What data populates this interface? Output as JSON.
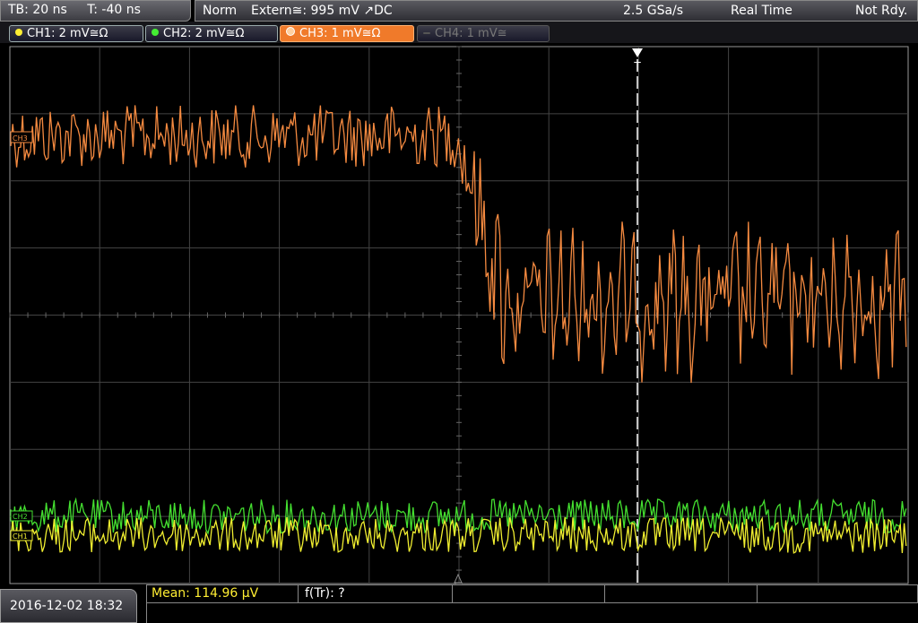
{
  "topbar": {
    "timebase": "TB: 20 ns",
    "trigger_time": "T: -40 ns",
    "trigger_mode": "Norm",
    "trigger_source": "Extern≅: 995 mV ↗DC",
    "sample_rate": "2.5 GSa/s",
    "acq_mode": "Real Time",
    "state": "Not Rdy."
  },
  "channels": [
    {
      "label": "CH1: 2 mV≅Ω",
      "color": "#ffee33"
    },
    {
      "label": "CH2: 2 mV≅Ω",
      "color": "#44ee33"
    },
    {
      "label": "CH3: 1 mV≅Ω",
      "color": "#ff8a3a"
    },
    {
      "label": "CH4: 1 mV≅",
      "color": "#888888"
    }
  ],
  "markers": {
    "ch3_ref": "CH3",
    "ch2_ref": "CH2",
    "ch1_ref": "CH1",
    "trigger": "T"
  },
  "bottom": {
    "datetime": "2016-12-02 18:32",
    "mean": "Mean: 114.96 µV",
    "f_tr": "f(Tr): ?"
  }
}
